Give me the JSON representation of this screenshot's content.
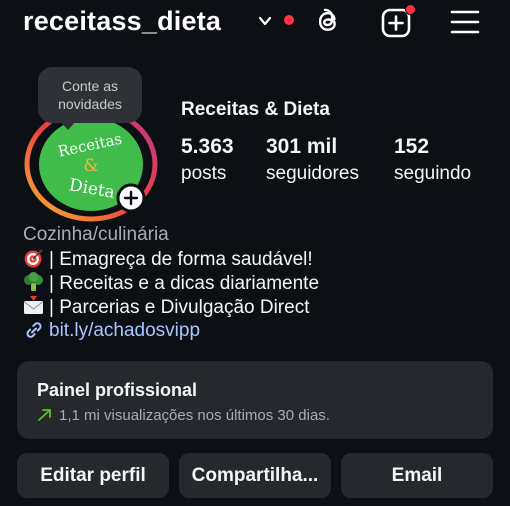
{
  "header": {
    "username": "receitass_dieta",
    "icons": {
      "threads": "threads-icon",
      "create": "add-square-icon",
      "menu": "hamburger-menu-icon"
    }
  },
  "profile": {
    "note_bubble": {
      "line1": "Conte as",
      "line2": "novidades"
    },
    "display_name": "Receitas & Dieta",
    "avatar_text": "Receitas & Dieta",
    "stats": [
      {
        "value": "5.363",
        "label": "posts"
      },
      {
        "value": "301 mil",
        "label": "seguidores"
      },
      {
        "value": "152",
        "label": "seguindo"
      }
    ]
  },
  "bio": {
    "category": "Cozinha/culinária",
    "lines": [
      {
        "icon": "target-emoji",
        "text": "| Emagreça de forma saudável!"
      },
      {
        "icon": "broccoli-emoji",
        "text": "| Receitas e a dicas diariamente"
      },
      {
        "icon": "envelope-emoji",
        "text": "| Parcerias e Divulgação Direct"
      }
    ],
    "link": "bit.ly/achadosvipp"
  },
  "professional_panel": {
    "title": "Painel profissional",
    "subtitle": "1,1 mi visualizações nos últimos 30 dias."
  },
  "actions": {
    "edit": "Editar perfil",
    "share": "Compartilha...",
    "email": "Email"
  },
  "colors": {
    "background": "#0c0f14",
    "surface": "#25282d",
    "link": "#a6c8ff",
    "notification": "#ff3040",
    "trend": "#58c322",
    "avatar_green": "#3fbc4a"
  }
}
